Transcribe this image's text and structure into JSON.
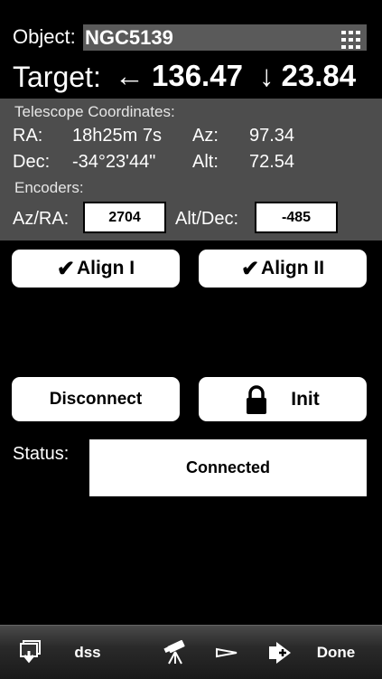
{
  "object": {
    "label": "Object:",
    "value": "NGC5139",
    "icon": "grid-icon"
  },
  "target": {
    "label": "Target:",
    "ra_arrow": "←",
    "ra": "136.47",
    "dec_arrow": "↓",
    "dec": "23.84"
  },
  "telescope": {
    "title": "Telescope Coordinates:",
    "ra_label": "RA:",
    "ra_value": "18h25m 7s",
    "az_label": "Az:",
    "az_value": "97.34",
    "dec_label": "Dec:",
    "dec_value": "-34°23'44\"",
    "alt_label": "Alt:",
    "alt_value": "72.54"
  },
  "encoders": {
    "title": "Encoders:",
    "azra_label": "Az/RA:",
    "azra_value": "2704",
    "altdec_label": "Alt/Dec:",
    "altdec_value": "-485"
  },
  "buttons": {
    "align1": "Align I",
    "align2": "Align II",
    "disconnect": "Disconnect",
    "init": "Init",
    "check_glyph": "✔"
  },
  "status": {
    "label": "Status:",
    "value": "Connected"
  },
  "toolbar": {
    "dss": "dss",
    "done": "Done",
    "icons": [
      "download-stack-icon",
      "telescope-icon",
      "pointer-arrow-icon",
      "add-arrow-icon"
    ]
  },
  "colors": {
    "background": "#000000",
    "panel": "#4d4d4d",
    "object_field": "#5a5a5a"
  }
}
